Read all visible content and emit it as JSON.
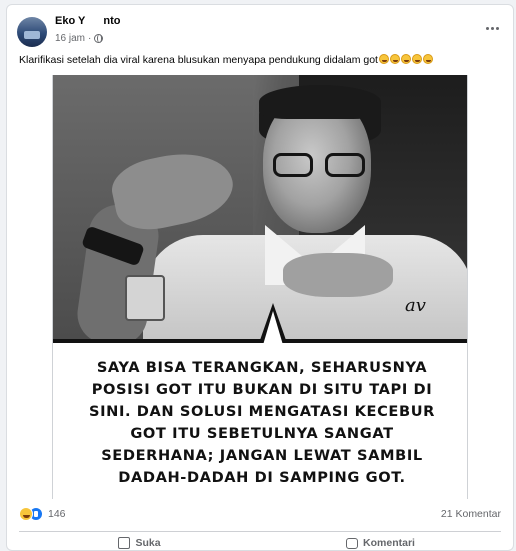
{
  "post": {
    "author_visible_start": "Eko Y",
    "author_visible_end": "nto",
    "time": "16 jam",
    "caption": "Klarifikasi setelah dia viral karena blusukan menyapa pendukung didalam got"
  },
  "image": {
    "quote_lines": [
      "Saya bisa terangkan, seharusnya",
      "posisi got itu bukan di situ tapi di",
      "sini. Dan solusi mengatasi kecebur",
      "got itu sebetulnya sangat",
      "sederhana; jangan lewat sambil",
      "dadah-dadah di samping got."
    ],
    "signature": "av"
  },
  "stats": {
    "reaction_count": "146",
    "comments": "21 Komentar"
  },
  "actions": {
    "like": "Suka",
    "comment": "Komentari"
  }
}
